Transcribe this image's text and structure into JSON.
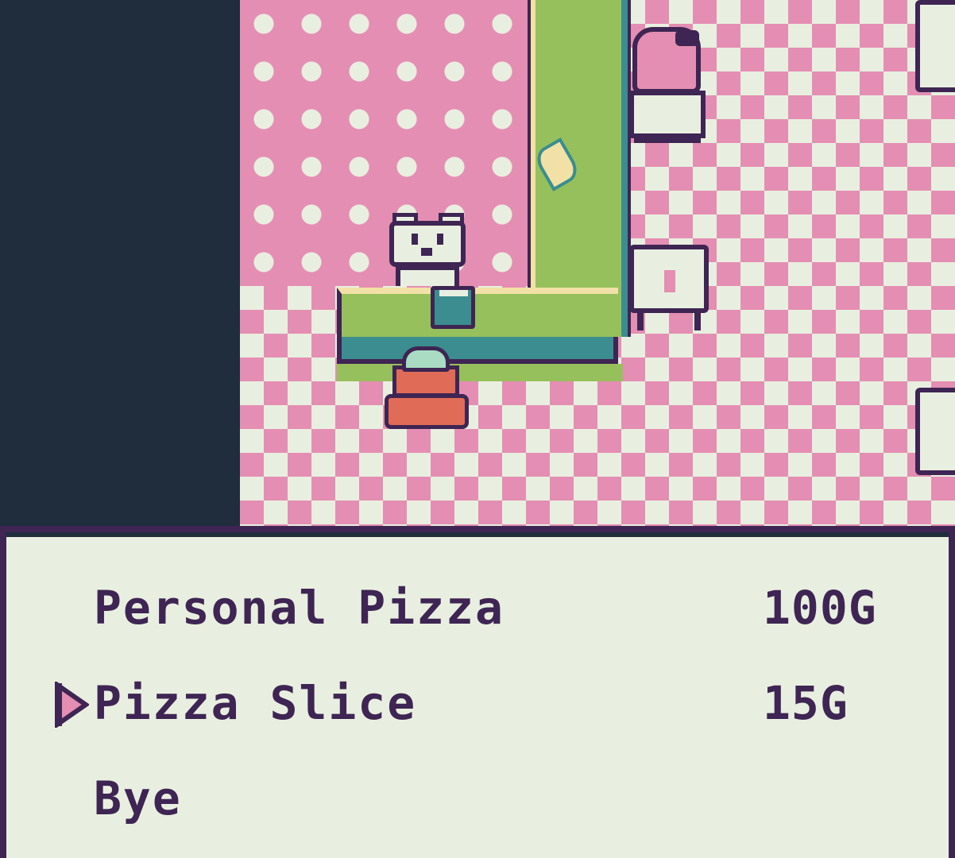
{
  "shop_menu": {
    "items": [
      {
        "label": "Personal Pizza",
        "price": "100G",
        "selected": false
      },
      {
        "label": "Pizza Slice",
        "price": "15G",
        "selected": true
      },
      {
        "label": "Bye",
        "price": "",
        "selected": false
      }
    ],
    "cursor_icon": "triangle-right-icon"
  },
  "palette": {
    "dark": "#3e2553",
    "void": "#1f2d3d",
    "light": "#e9efe0",
    "pink": "#e48eb3",
    "green": "#96c05b",
    "teal": "#3b8d8f",
    "cream": "#f2e1a6",
    "orange": "#e06c57"
  }
}
